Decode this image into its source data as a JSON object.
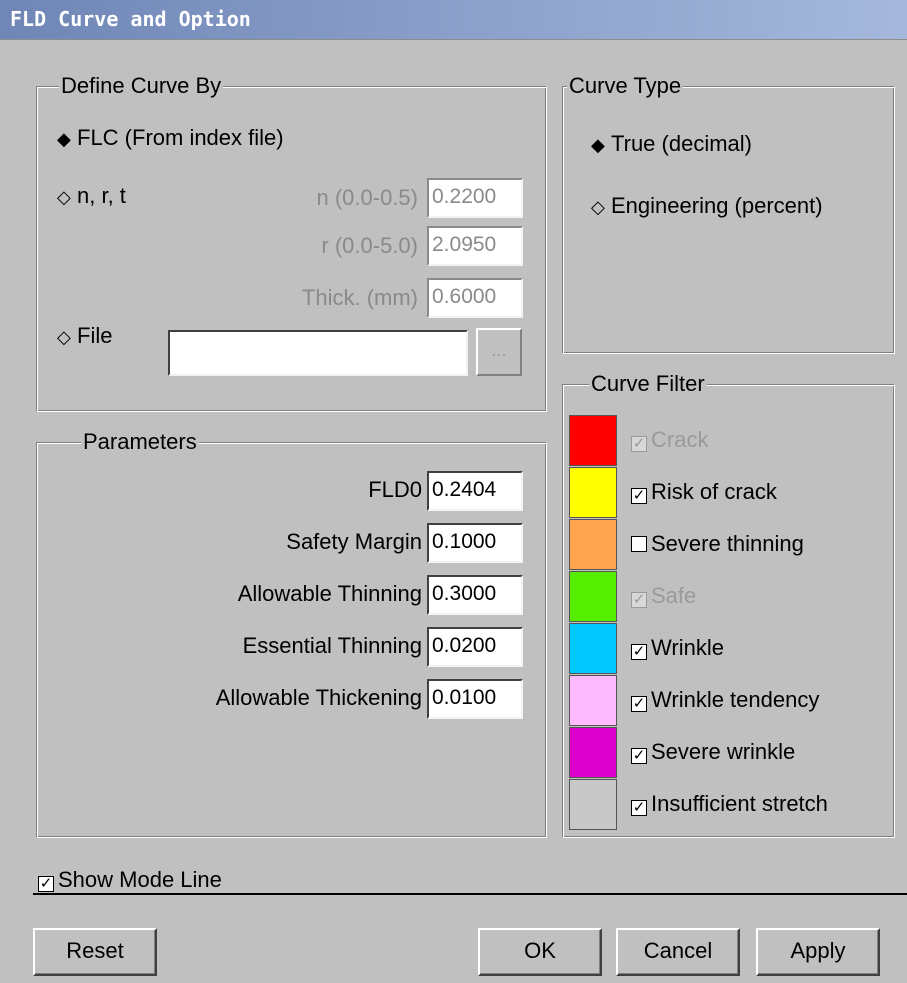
{
  "window": {
    "title": "FLD Curve and Option"
  },
  "define_curve": {
    "legend": "Define Curve By",
    "option_flc": "FLC (From index file)",
    "option_nrt": "n, r, t",
    "option_file": "File",
    "n_label": "n (0.0-0.5)",
    "n_value": "0.2200",
    "r_label": "r (0.0-5.0)",
    "r_value": "2.0950",
    "thick_label": "Thick. (mm)",
    "thick_value": "0.6000",
    "file_value": "",
    "browse_label": "..."
  },
  "curve_type": {
    "legend": "Curve Type",
    "option_true": "True (decimal)",
    "option_engineering": "Engineering (percent)"
  },
  "parameters": {
    "legend": "Parameters",
    "rows": [
      {
        "label": "FLD0",
        "value": "0.2404"
      },
      {
        "label": "Safety Margin",
        "value": "0.1000"
      },
      {
        "label": "Allowable Thinning",
        "value": "0.3000"
      },
      {
        "label": "Essential Thinning",
        "value": "0.0200"
      },
      {
        "label": "Allowable Thickening",
        "value": "0.0100"
      }
    ]
  },
  "curve_filter": {
    "legend": "Curve Filter",
    "items": [
      {
        "label": "Crack",
        "color": "#ff0000",
        "checked": true,
        "enabled": false
      },
      {
        "label": "Risk of crack",
        "color": "#ffff00",
        "checked": true,
        "enabled": true
      },
      {
        "label": "Severe thinning",
        "color": "#ffa54f",
        "checked": false,
        "enabled": true
      },
      {
        "label": "Safe",
        "color": "#55ee00",
        "checked": true,
        "enabled": false
      },
      {
        "label": "Wrinkle",
        "color": "#00c8ff",
        "checked": true,
        "enabled": true
      },
      {
        "label": "Wrinkle tendency",
        "color": "#ffbbff",
        "checked": true,
        "enabled": true
      },
      {
        "label": "Severe wrinkle",
        "color": "#dd00cc",
        "checked": true,
        "enabled": true
      },
      {
        "label": "Insufficient stretch",
        "color": "#c8c8c8",
        "checked": true,
        "enabled": true
      }
    ]
  },
  "show_mode_line": {
    "label": "Show Mode Line",
    "checked": true
  },
  "buttons": {
    "reset": "Reset",
    "ok": "OK",
    "cancel": "Cancel",
    "apply": "Apply"
  }
}
